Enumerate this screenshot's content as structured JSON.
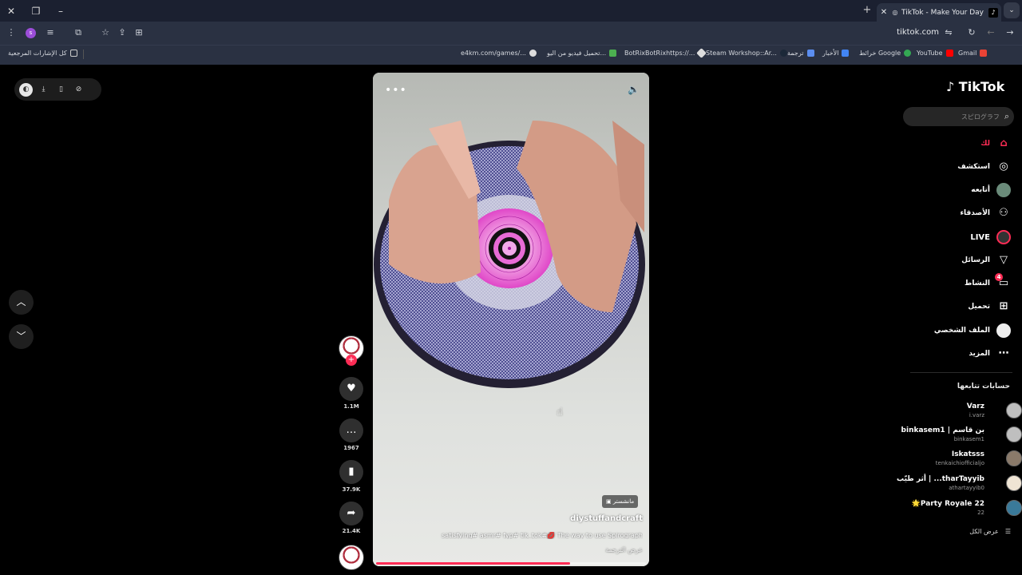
{
  "browser": {
    "tab_title": "TikTok - Make Your Day",
    "url": "tiktok.com",
    "bookmarks": [
      {
        "label": "Gmail"
      },
      {
        "label": "YouTube"
      },
      {
        "label": "خرائط Google"
      },
      {
        "label": "الأخبار"
      },
      {
        "label": "ترجمة"
      },
      {
        "label": "Steam Workshop::Ar..."
      },
      {
        "label": "BotRixBotRixhttps://..."
      },
      {
        "label": "تحميل فيديو من اليو..."
      },
      {
        "label": "e4km.com/games/..."
      },
      {
        "label": "كل الإشارات المرجعية"
      }
    ]
  },
  "video": {
    "creator_badge": "مانشستر",
    "author": "diystuffandcraft",
    "description": "satisfying# asmr# fyp# tik_tok#💋 The way to use Spirograph",
    "translation": "عرض الترجمة",
    "progress": 0.72
  },
  "actions": {
    "likes": "1.1M",
    "comments": "1967",
    "saves": "37.9K",
    "shares": "21.4K"
  },
  "sidebar": {
    "logo": "TikTok",
    "search_placeholder": "スピログラフ",
    "nav": [
      {
        "label": "لك",
        "icon": "home-icon"
      },
      {
        "label": "استكشف",
        "icon": "compass-icon"
      },
      {
        "label": "أتابعه",
        "icon": "avatar"
      },
      {
        "label": "الأصدقاء",
        "icon": "friends-icon"
      },
      {
        "label": "LIVE",
        "icon": "live-icon"
      },
      {
        "label": "الرسائل",
        "icon": "send-icon"
      },
      {
        "label": "النشاط",
        "icon": "activity-icon",
        "badge": "4"
      },
      {
        "label": "تحميل",
        "icon": "upload-icon"
      },
      {
        "label": "الملف الشخصي",
        "icon": "profile-icon"
      },
      {
        "label": "المزيد",
        "icon": "more-icon"
      }
    ],
    "following_title": "حسابات تتابعها",
    "following": [
      {
        "name": "Varz",
        "handle": "i.varz"
      },
      {
        "name": "binkasem1 | بن قاسم",
        "handle": "binkasem1"
      },
      {
        "name": "Iskatsss",
        "handle": "tenkaichiofficialjo"
      },
      {
        "name": "أثر طيّب | ...tharTayyib",
        "handle": "athartayyib0"
      },
      {
        "name": "🌟Party Royale 22",
        "handle": "22"
      }
    ],
    "see_all": "عرض الكل"
  }
}
